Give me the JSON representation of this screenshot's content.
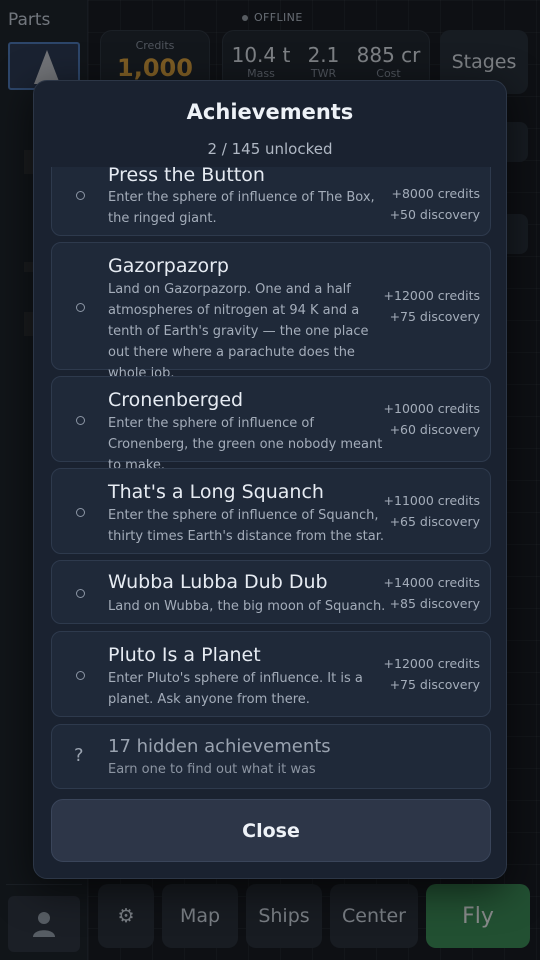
{
  "sidebar": {
    "title": "Parts"
  },
  "status": {
    "offline_label": "OFFLINE"
  },
  "header": {
    "credits_label": "Credits",
    "credits_value": "1,000",
    "stats": [
      {
        "value": "10.4 t",
        "label": "Mass"
      },
      {
        "value": "2.1",
        "label": "TWR"
      },
      {
        "value": "885 cr",
        "label": "Cost"
      }
    ],
    "stages_label": "Stages"
  },
  "bottom_nav": {
    "settings_icon": "gear-icon",
    "map": "Map",
    "ships": "Ships",
    "center": "Center",
    "fly": "Fly"
  },
  "modal": {
    "title": "Achievements",
    "unlocked": "2 / 145 unlocked",
    "achievements": [
      {
        "title": "Press the Button",
        "description": "Enter the sphere of influence of The Box, the ringed giant.",
        "reward_credits": "+8000 credits",
        "reward_discovery": "+50 discovery"
      },
      {
        "title": "Gazorpazorp",
        "description": "Land on Gazorpazorp. One and a half atmospheres of nitrogen at 94 K and a tenth of Earth's gravity — the one place out there where a parachute does the whole job.",
        "reward_credits": "+12000 credits",
        "reward_discovery": "+75 discovery"
      },
      {
        "title": "Cronenberged",
        "description": "Enter the sphere of influence of Cronenberg, the green one nobody meant to make.",
        "reward_credits": "+10000 credits",
        "reward_discovery": "+60 discovery"
      },
      {
        "title": "That's a Long Squanch",
        "description": "Enter the sphere of influence of Squanch, thirty times Earth's distance from the star.",
        "reward_credits": "+11000 credits",
        "reward_discovery": "+65 discovery"
      },
      {
        "title": "Wubba Lubba Dub Dub",
        "description": "Land on Wubba, the big moon of Squanch.",
        "reward_credits": "+14000 credits",
        "reward_discovery": "+85 discovery"
      },
      {
        "title": "Pluto Is a Planet",
        "description": "Enter Pluto's sphere of influence. It is a planet. Ask anyone from there.",
        "reward_credits": "+12000 credits",
        "reward_discovery": "+75 discovery"
      }
    ],
    "hidden": {
      "symbol": "?",
      "title": "17 hidden achievements",
      "description": "Earn one to find out what it was"
    },
    "close_label": "Close"
  }
}
